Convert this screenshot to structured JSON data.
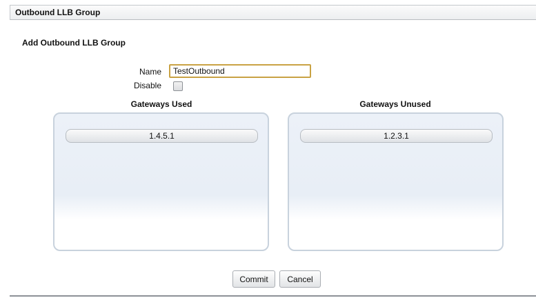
{
  "header": {
    "title": "Outbound LLB Group"
  },
  "form": {
    "heading": "Add Outbound LLB Group",
    "name_label": "Name",
    "name_value": "TestOutbound",
    "disable_label": "Disable",
    "disable_checked": false
  },
  "gateways_used": {
    "heading": "Gateways Used",
    "items": [
      "1.4.5.1"
    ]
  },
  "gateways_unused": {
    "heading": "Gateways Unused",
    "items": [
      "1.2.3.1"
    ]
  },
  "actions": {
    "commit_label": "Commit",
    "cancel_label": "Cancel"
  },
  "colors": {
    "input_focus_border": "#c9a243",
    "list_border": "#c8d2dd",
    "list_fill": "#ecf1f8"
  }
}
